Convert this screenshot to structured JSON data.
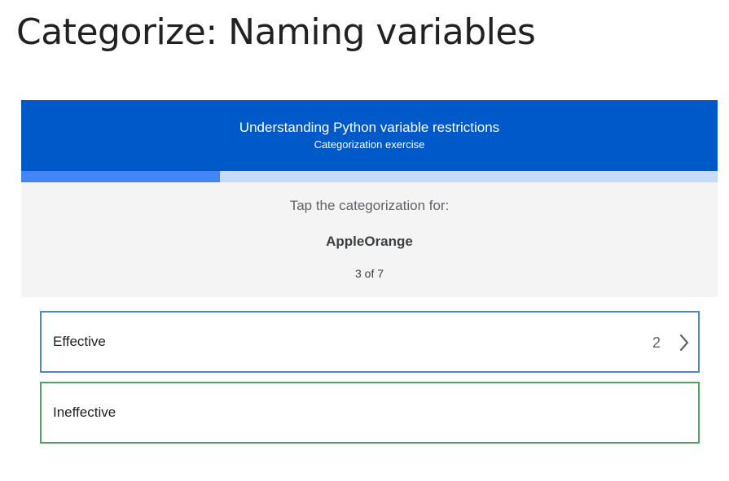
{
  "page": {
    "title": "Categorize: Naming variables"
  },
  "exercise": {
    "header": {
      "title": "Understanding Python variable restrictions",
      "subtitle": "Categorization exercise"
    },
    "progress": {
      "current": 3,
      "total": 7,
      "fraction": 0.2857
    },
    "prompt": "Tap the categorization for:",
    "term": "AppleOrange",
    "counter_text": "3 of 7",
    "categories": [
      {
        "label": "Effective",
        "count": "2",
        "icon": "chevron-right-icon",
        "border_color": "#4a86d8"
      },
      {
        "label": "Ineffective",
        "count": "",
        "icon": "",
        "border_color": "#4ca25e"
      }
    ]
  },
  "colors": {
    "header_bg": "#0059c9",
    "progress_fill": "#4285f4",
    "progress_track": "#c6dafc",
    "panel_bg": "#f4f4f4"
  }
}
